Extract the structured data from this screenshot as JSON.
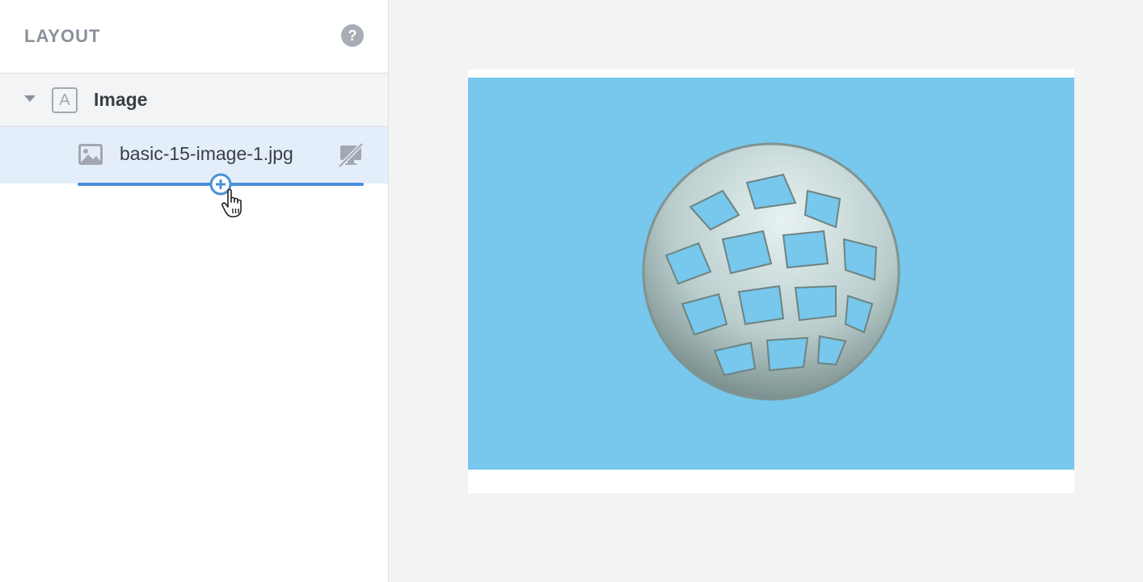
{
  "sidebar": {
    "title": "LAYOUT",
    "help_icon": "help-circle-icon",
    "help_glyph": "?",
    "group": {
      "label": "Image",
      "type_glyph": "A",
      "expanded": true,
      "caret_icon": "caret-down-icon"
    },
    "item": {
      "label": "basic-15-image-1.jpg",
      "icon": "image-icon",
      "visibility_icon": "hidden-on-desktop-icon",
      "selected": true
    },
    "drop_indicator": {
      "icon": "add-circle-icon",
      "color": "#4a90d9"
    }
  },
  "canvas": {
    "background": "#f3f3f3",
    "image": {
      "subject": "wireframe-sphere",
      "background_color": "#78c7ec"
    }
  },
  "colors": {
    "accent": "#4a90d9",
    "selected_row": "#e4eefb",
    "muted_text": "#8a919c"
  }
}
